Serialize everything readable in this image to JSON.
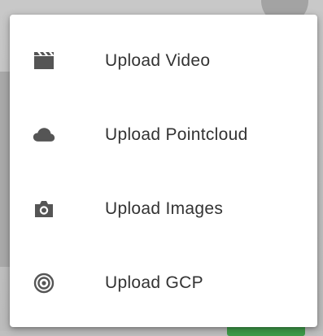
{
  "menu": {
    "items": [
      {
        "label": "Upload Video",
        "icon": "video-clapperboard-icon"
      },
      {
        "label": "Upload Pointcloud",
        "icon": "cloud-icon"
      },
      {
        "label": "Upload Images",
        "icon": "camera-icon"
      },
      {
        "label": "Upload GCP",
        "icon": "target-icon"
      }
    ]
  },
  "colors": {
    "menu_background": "#ffffff",
    "text": "#333333",
    "icon": "#555555"
  }
}
